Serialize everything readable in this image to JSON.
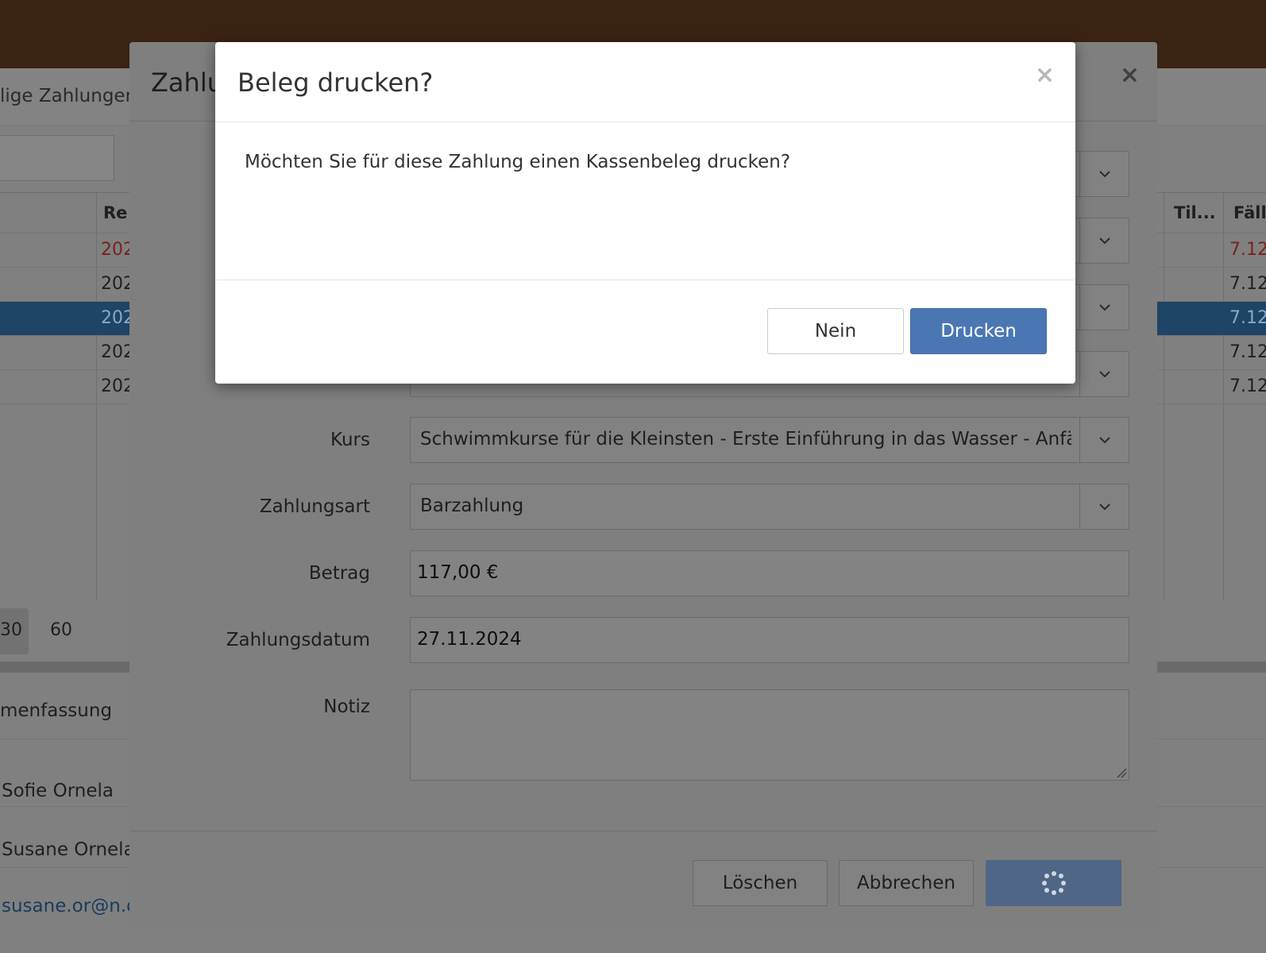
{
  "background": {
    "tab_label": "lige Zahlungen",
    "table_headers": {
      "col_re": "Re",
      "col_til": "Til...",
      "col_faell": "Fäll"
    },
    "rows": [
      {
        "col1": "202",
        "col2": "7.12",
        "status": "overdue"
      },
      {
        "col1": "202",
        "col2": "7.12",
        "status": "normal"
      },
      {
        "col1": "202",
        "col2": "7.12",
        "status": "selected"
      },
      {
        "col1": "202",
        "col2": "7.12",
        "status": "normal"
      },
      {
        "col1": "202",
        "col2": "7.12",
        "status": "normal"
      }
    ],
    "pager": {
      "size_a": "30",
      "size_b": "60"
    },
    "summary_title": "menfassung",
    "person_1": "Sofie Ornela",
    "person_2": "Susane Ornela",
    "email": "susane.or@n.d"
  },
  "payment_modal": {
    "title": "Zahlu",
    "fields": {
      "kurs_label": "Kurs",
      "kurs_value": "Schwimmkurse für die Kleinsten - Erste Einführung in das Wasser - Anfänger",
      "zahlungsart_label": "Zahlungsart",
      "zahlungsart_value": "Barzahlung",
      "betrag_label": "Betrag",
      "betrag_value": "117,00 €",
      "datum_label": "Zahlungsdatum",
      "datum_value": "27.11.2024",
      "notiz_label": "Notiz",
      "notiz_value": ""
    },
    "buttons": {
      "delete": "Löschen",
      "cancel": "Abbrechen"
    }
  },
  "confirm_dialog": {
    "title": "Beleg drucken?",
    "close_symbol": "×",
    "message": "Möchten Sie für diese Zahlung einen Kassenbeleg drucken?",
    "no_label": "Nein",
    "yes_label": "Drucken"
  },
  "colors": {
    "primary": "#4a77b4",
    "topbar": "#3a2312",
    "selected_row": "#1e4466"
  },
  "icons": [
    "close-icon",
    "chevron-down-icon",
    "spinner-icon",
    "resize-grip-icon"
  ]
}
